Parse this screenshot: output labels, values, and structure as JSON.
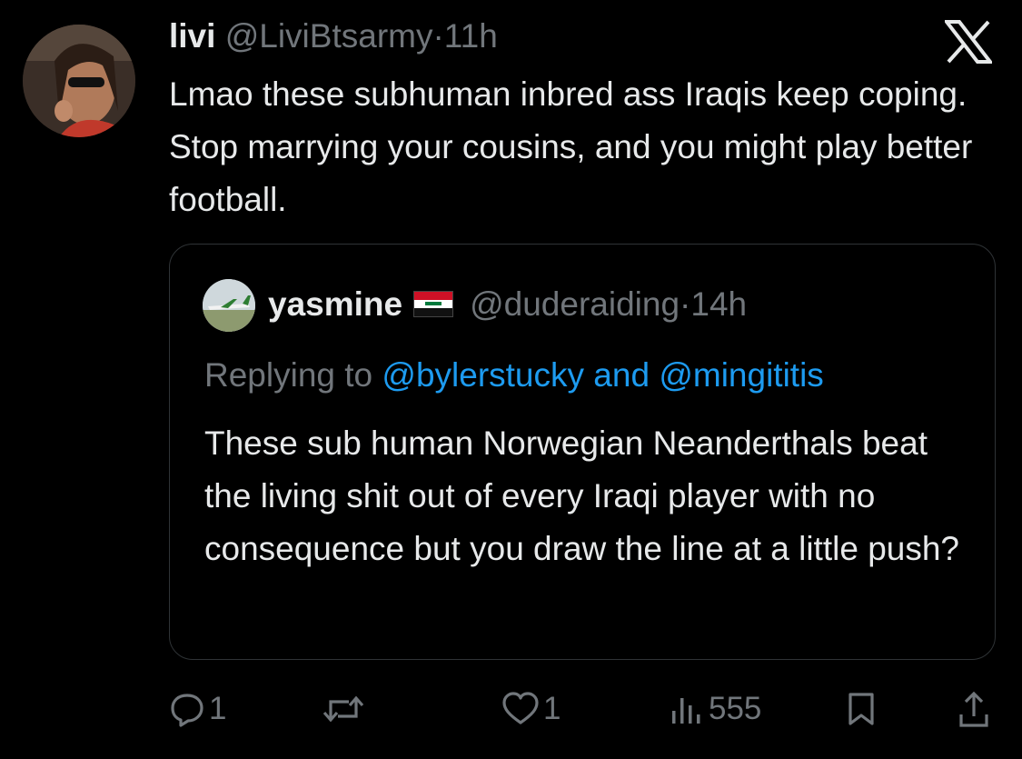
{
  "tweet": {
    "author_name": "livi",
    "author_handle": "@LiviBtsarmy",
    "separator": "·",
    "time": "11h",
    "text": "Lmao these subhuman inbred ass Iraqis keep coping. Stop marrying your cousins, and you might play better football."
  },
  "quoted_tweet": {
    "author_name": "yasmine",
    "flag_icon": "iraq-flag-icon",
    "author_handle": "@duderaiding",
    "separator": "·",
    "time": "14h",
    "replying_prefix": "Replying to",
    "reply_user_1": "@bylerstucky",
    "reply_joiner": "and",
    "reply_user_2": "@mingititis",
    "text": "These sub human Norwegian Neanderthals beat the living shit out of every Iraqi player with no consequence but you draw the line at a little push?"
  },
  "actions": {
    "replies": "1",
    "retweets": "",
    "likes": "1",
    "views": "555"
  },
  "colors": {
    "background": "#000000",
    "text": "#e7e9ea",
    "secondary": "#71767b",
    "link": "#1d9bf0",
    "border": "#2f3336"
  }
}
